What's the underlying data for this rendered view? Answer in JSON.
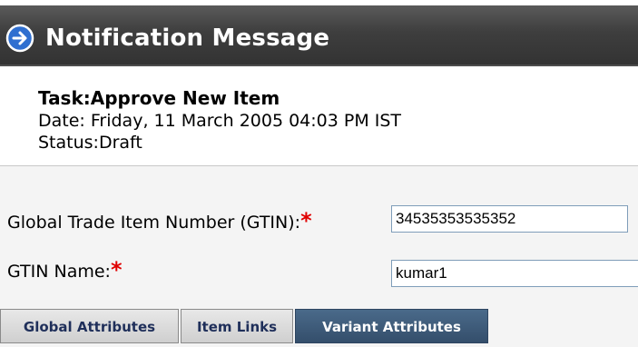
{
  "header": {
    "title": "Notification Message",
    "icon": "circle-arrow-right-icon",
    "icon_color": "#2f6fd0"
  },
  "task": {
    "title": "Task:Approve New Item",
    "date": "Date: Friday, 11 March 2005 04:03 PM IST",
    "status": "Status:Draft"
  },
  "form": {
    "gtin_label": "Global Trade Item Number (GTIN):",
    "gtin_value": "34535353535352",
    "gtin_name_label": "GTIN Name:",
    "gtin_name_value": "kumar1",
    "required_marker": "*",
    "required_color": "#e00000"
  },
  "tabs": [
    {
      "label": "Global Attributes",
      "active": false
    },
    {
      "label": "Item Links",
      "active": false
    },
    {
      "label": "Variant Attributes",
      "active": true
    }
  ]
}
